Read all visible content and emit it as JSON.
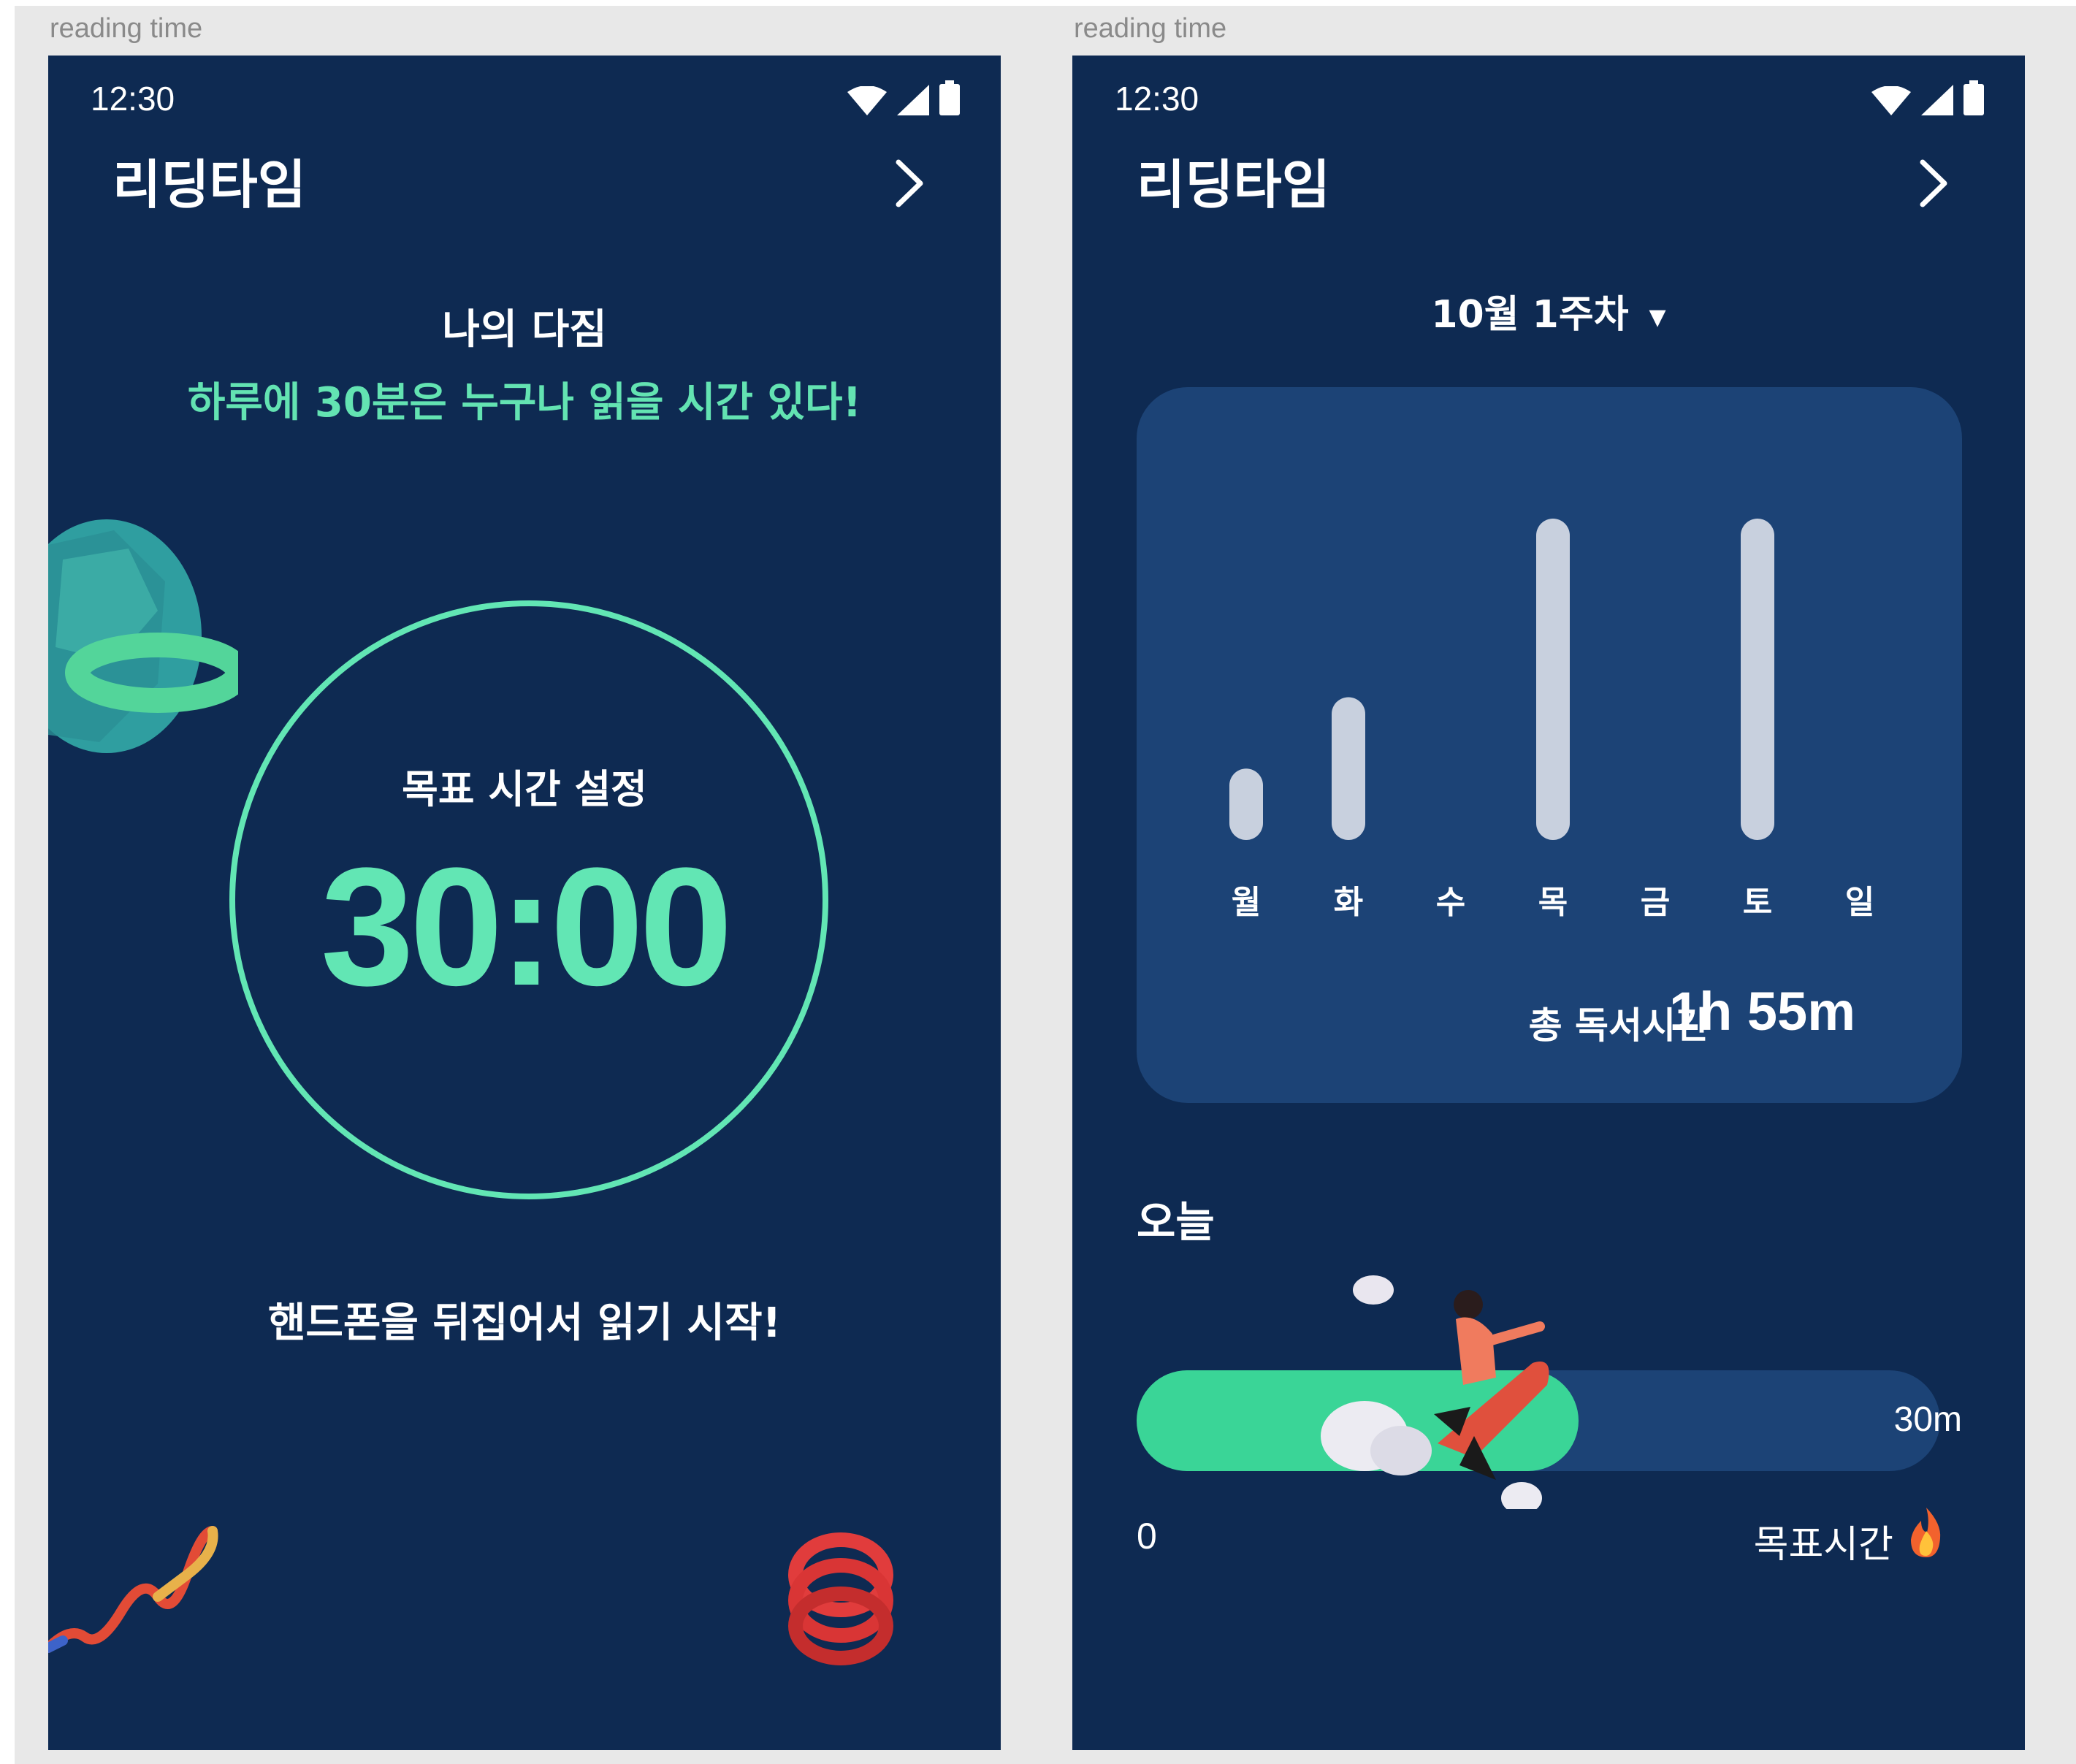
{
  "frames": [
    {
      "label": "reading time",
      "status_time": "12:30",
      "app_title": "리딩타임",
      "pledge_title": "나의 다짐",
      "pledge_text": "하루에 30분은 누구나 읽을 시간 있다!",
      "goal_label": "목표 시간 설정",
      "goal_value": "30:00",
      "start_hint": "핸드폰을 뒤집어서 읽기 시작!"
    },
    {
      "label": "reading time",
      "status_time": "12:30",
      "app_title": "리딩타임",
      "week_selector": "10월 1주차",
      "total_label": "총 독서시간",
      "total_value": "1h 55m",
      "today_label": "오늘",
      "progress_value_label": "30m",
      "progress_fraction": 0.55,
      "axis_start": "0",
      "axis_goal": "목표시간"
    }
  ],
  "icons": [
    "wifi-icon",
    "signal-icon",
    "battery-icon",
    "chevron-right-icon",
    "dropdown-arrow-icon",
    "fire-icon"
  ],
  "colors": {
    "background": "#0e2a52",
    "card": "#1c4376",
    "accent": "#62e6b4",
    "progress": "#3ad597",
    "bar": "#c8d0de"
  },
  "chart_data": {
    "type": "bar",
    "categories": [
      "월",
      "화",
      "수",
      "목",
      "금",
      "토",
      "일"
    ],
    "values": [
      10,
      20,
      0,
      45,
      0,
      45,
      0
    ],
    "title": "",
    "xlabel": "",
    "ylabel": ""
  }
}
